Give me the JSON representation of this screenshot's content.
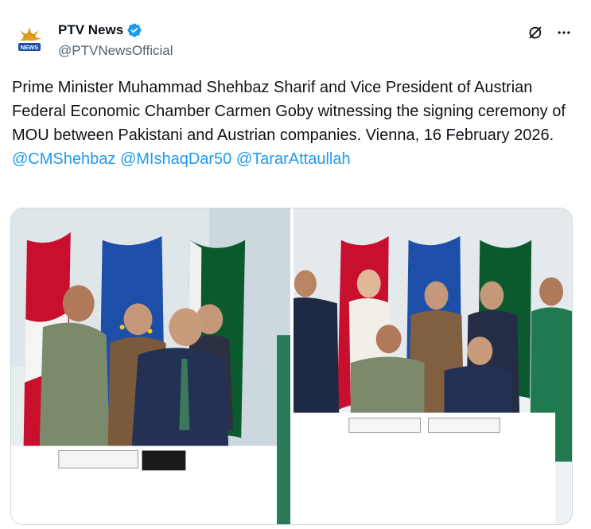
{
  "account": {
    "display_name": "PTV News",
    "handle": "@PTVNewsOfficial",
    "verified": true,
    "avatar_logo_text": "NEWS"
  },
  "tweet": {
    "text_plain": "Prime Minister Muhammad Shehbaz Sharif and Vice President of Austrian Federal Economic Chamber Carmen Goby witnessing the signing ceremony of MOU between Pakistani and Austrian companies. Vienna, 16 February 2026. ",
    "mentions": [
      "@CMShehbaz",
      "@MIshaqDar50",
      "@TararAttaullah"
    ]
  },
  "icons": {
    "verified": "verified-badge-icon",
    "grok": "grok-icon",
    "more": "more-options-icon"
  },
  "colors": {
    "text": "#0f1419",
    "secondary": "#536471",
    "link": "#1d9bf0",
    "border": "#cfd9de"
  }
}
